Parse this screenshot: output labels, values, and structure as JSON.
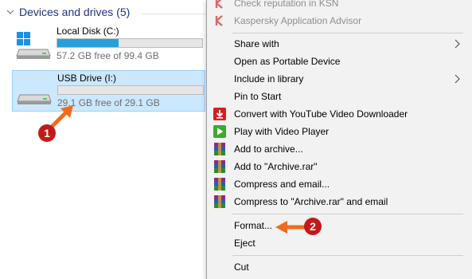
{
  "explorer": {
    "section_title": "Devices and drives (5)",
    "drives": [
      {
        "name": "Local Disk (C:)",
        "free_text": "57.2 GB free of 99.4 GB",
        "used_fraction": 0.425
      },
      {
        "name": "USB Drive (I:)",
        "free_text": "29.1 GB free of 29.1 GB",
        "used_fraction": 0.0
      }
    ]
  },
  "annotations": {
    "step1": "1",
    "step2": "2",
    "color": "#c41919",
    "arrow_color": "#f26b1d"
  },
  "menu": {
    "items": [
      {
        "label": "Check reputation in KSN",
        "icon": "kaspersky-icon",
        "disabled": true
      },
      {
        "label": "Kaspersky Application Advisor",
        "icon": "kaspersky-icon",
        "disabled": true
      },
      {
        "label": "Share with",
        "submenu": true
      },
      {
        "label": "Open as Portable Device"
      },
      {
        "label": "Include in library",
        "submenu": true
      },
      {
        "label": "Pin to Start"
      },
      {
        "label": "Convert with YouTube Video Downloader",
        "icon": "download-icon"
      },
      {
        "label": "Play with Video Player",
        "icon": "play-icon"
      },
      {
        "label": "Add to archive...",
        "icon": "winrar-icon"
      },
      {
        "label": "Add to \"Archive.rar\"",
        "icon": "winrar-icon"
      },
      {
        "label": "Compress and email...",
        "icon": "winrar-icon"
      },
      {
        "label": "Compress to \"Archive.rar\" and email",
        "icon": "winrar-icon"
      },
      {
        "label": "Format..."
      },
      {
        "label": "Eject"
      },
      {
        "label": "Cut"
      }
    ]
  }
}
